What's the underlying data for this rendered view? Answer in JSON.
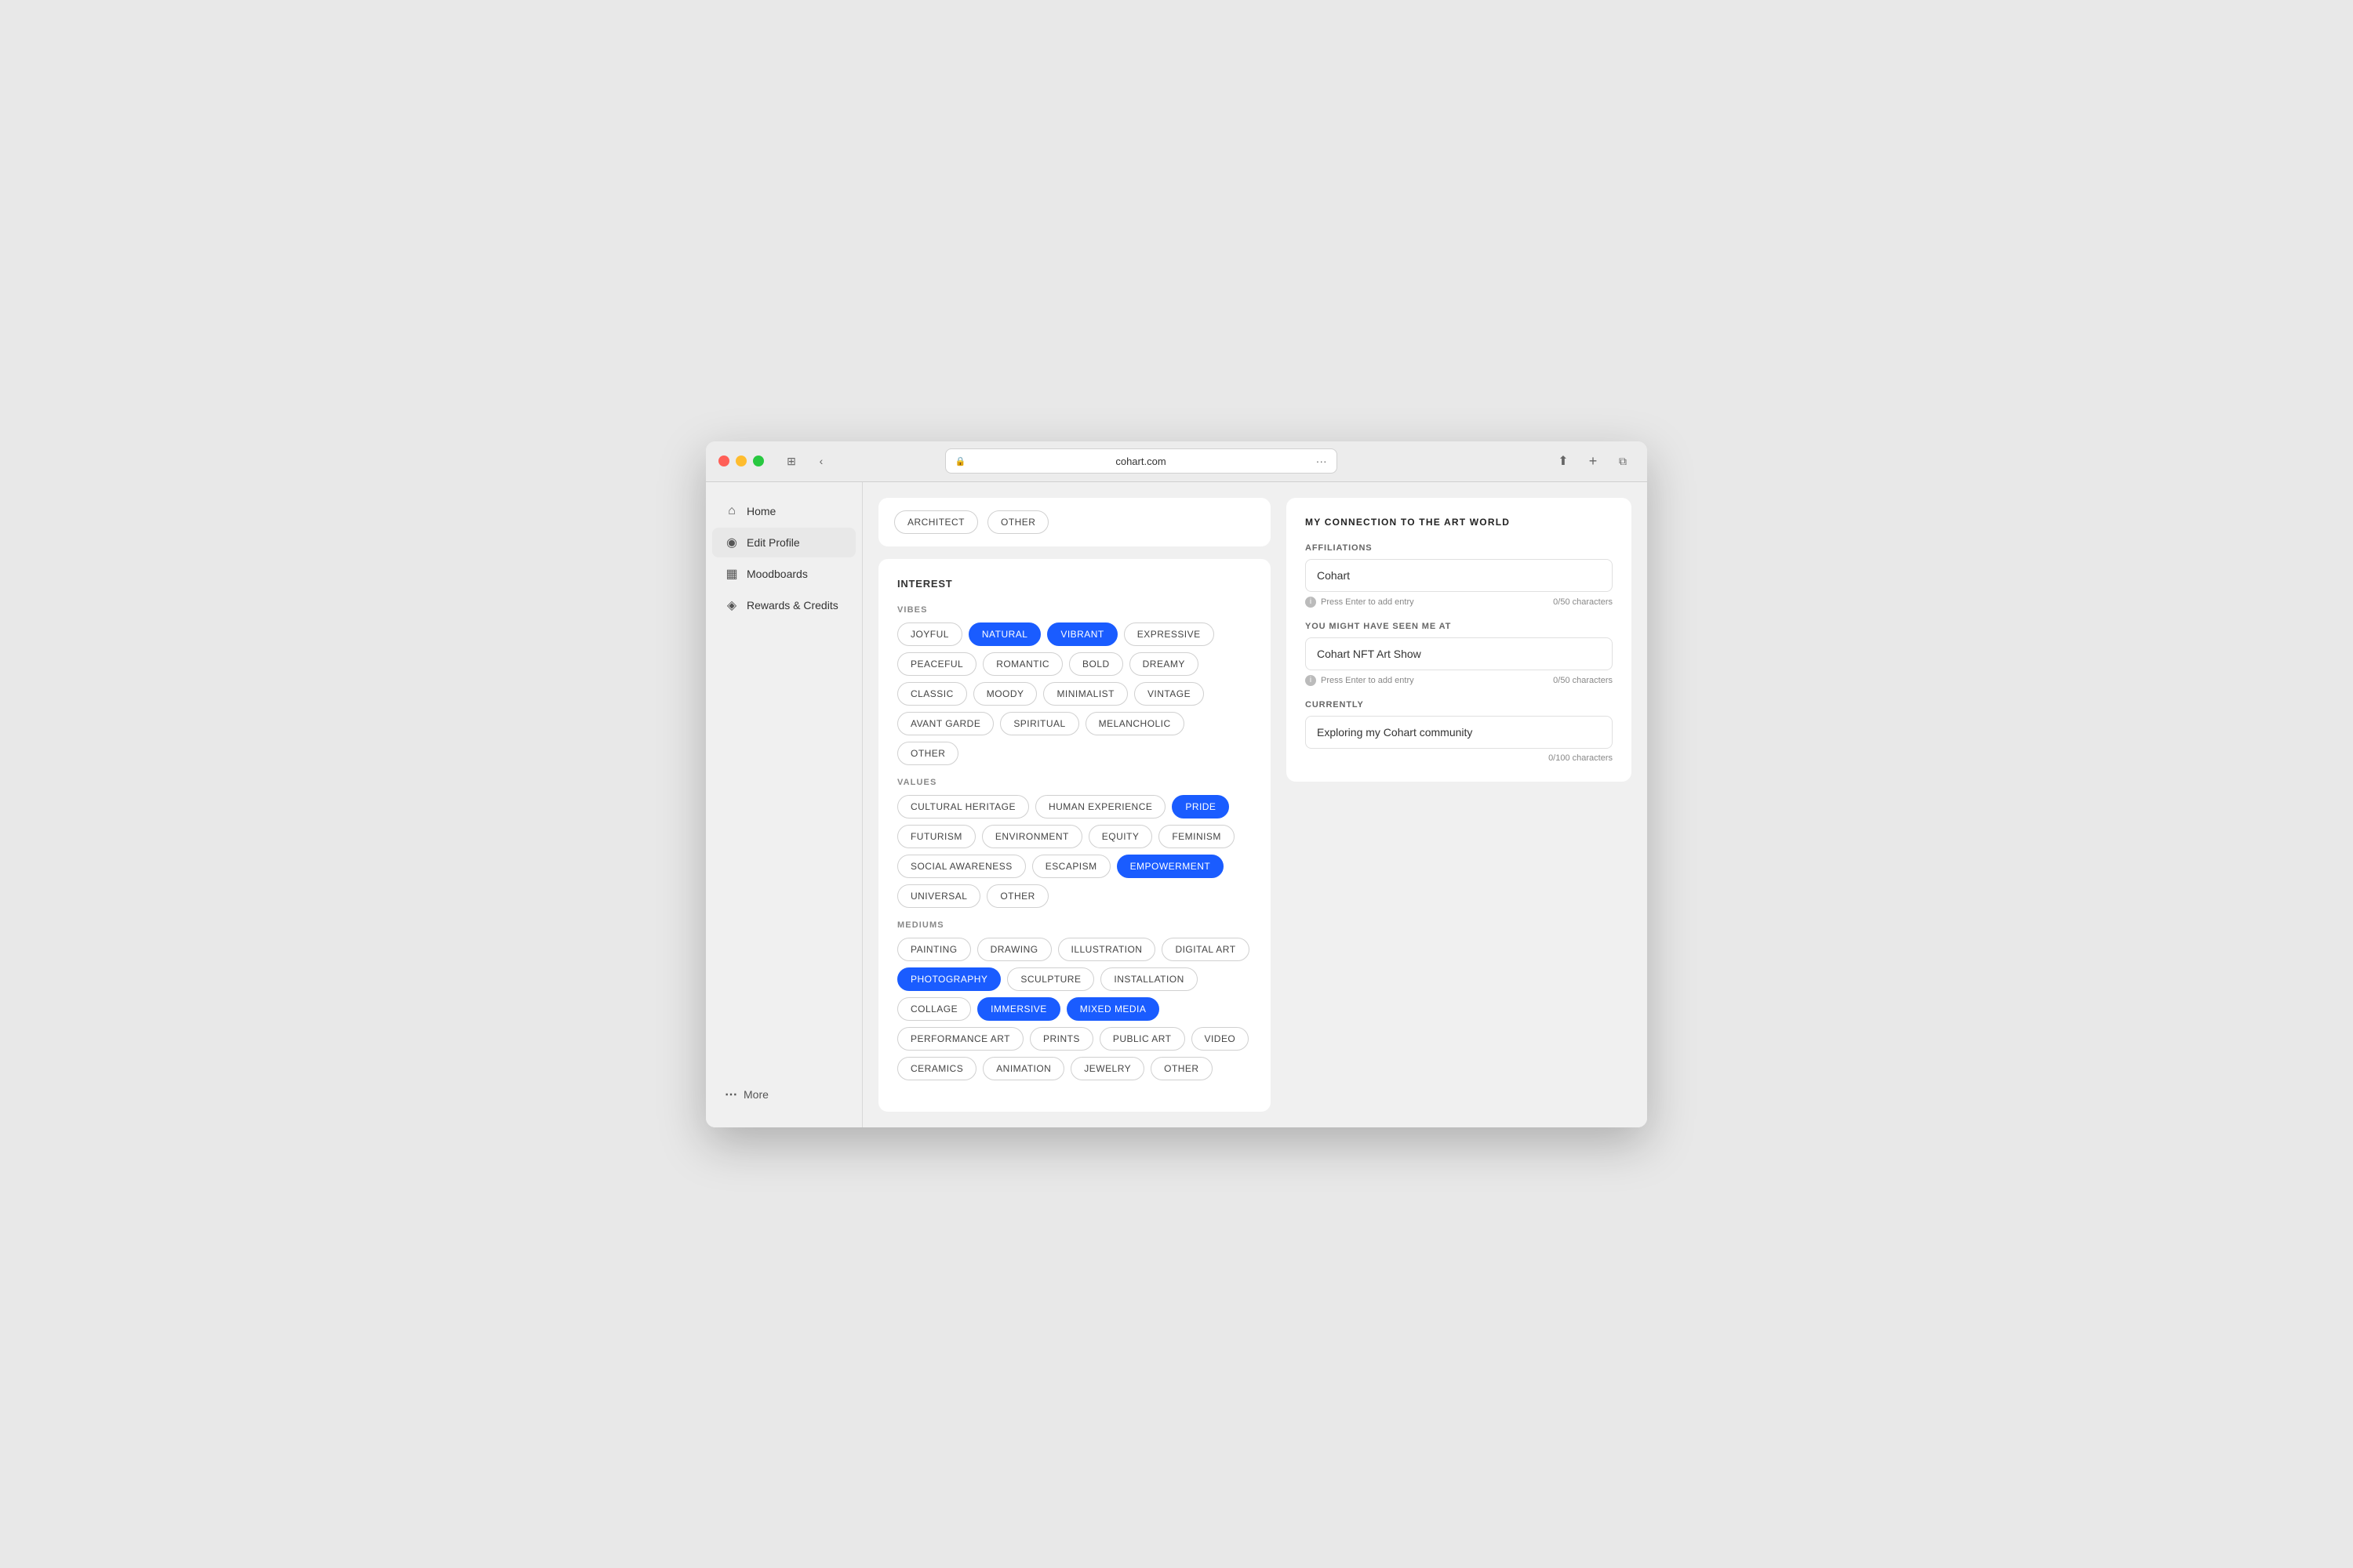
{
  "browser": {
    "url": "cohart.com",
    "lock_icon": "🔒",
    "dots_label": "···"
  },
  "sidebar": {
    "items": [
      {
        "id": "home",
        "label": "Home",
        "icon": "home",
        "active": false
      },
      {
        "id": "edit-profile",
        "label": "Edit Profile",
        "icon": "user",
        "active": true
      },
      {
        "id": "moodboards",
        "label": "Moodboards",
        "icon": "grid",
        "active": false
      },
      {
        "id": "rewards",
        "label": "Rewards & Credits",
        "icon": "gift",
        "active": false
      }
    ],
    "more_label": "More"
  },
  "top_tags": [
    {
      "label": "ARCHITECT",
      "active": false
    },
    {
      "label": "OTHER",
      "active": false
    }
  ],
  "interest": {
    "section_title": "INTEREST",
    "vibes": {
      "label": "VIBES",
      "tags": [
        {
          "label": "JOYFUL",
          "active": false
        },
        {
          "label": "NATURAL",
          "active": true
        },
        {
          "label": "VIBRANT",
          "active": true
        },
        {
          "label": "EXPRESSIVE",
          "active": false
        },
        {
          "label": "PEACEFUL",
          "active": false
        },
        {
          "label": "ROMANTIC",
          "active": false
        },
        {
          "label": "BOLD",
          "active": false
        },
        {
          "label": "DREAMY",
          "active": false
        },
        {
          "label": "CLASSIC",
          "active": false
        },
        {
          "label": "MOODY",
          "active": false
        },
        {
          "label": "MINIMALIST",
          "active": false
        },
        {
          "label": "VINTAGE",
          "active": false
        },
        {
          "label": "AVANT GARDE",
          "active": false
        },
        {
          "label": "SPIRITUAL",
          "active": false
        },
        {
          "label": "MELANCHOLIC",
          "active": false
        },
        {
          "label": "OTHER",
          "active": false
        }
      ]
    },
    "values": {
      "label": "VALUES",
      "tags": [
        {
          "label": "CULTURAL HERITAGE",
          "active": false
        },
        {
          "label": "HUMAN EXPERIENCE",
          "active": false
        },
        {
          "label": "PRIDE",
          "active": true
        },
        {
          "label": "FUTURISM",
          "active": false
        },
        {
          "label": "ENVIRONMENT",
          "active": false
        },
        {
          "label": "EQUITY",
          "active": false
        },
        {
          "label": "FEMINISM",
          "active": false
        },
        {
          "label": "SOCIAL AWARENESS",
          "active": false
        },
        {
          "label": "ESCAPISM",
          "active": false
        },
        {
          "label": "EMPOWERMENT",
          "active": true
        },
        {
          "label": "UNIVERSAL",
          "active": false
        },
        {
          "label": "OTHER",
          "active": false
        }
      ]
    },
    "mediums": {
      "label": "MEDIUMS",
      "tags": [
        {
          "label": "PAINTING",
          "active": false
        },
        {
          "label": "DRAWING",
          "active": false
        },
        {
          "label": "ILLUSTRATION",
          "active": false
        },
        {
          "label": "DIGITAL ART",
          "active": false
        },
        {
          "label": "PHOTOGRAPHY",
          "active": true
        },
        {
          "label": "SCULPTURE",
          "active": false
        },
        {
          "label": "INSTALLATION",
          "active": false
        },
        {
          "label": "COLLAGE",
          "active": false
        },
        {
          "label": "IMMERSIVE",
          "active": true
        },
        {
          "label": "MIXED MEDIA",
          "active": true
        },
        {
          "label": "PERFORMANCE ART",
          "active": false
        },
        {
          "label": "PRINTS",
          "active": false
        },
        {
          "label": "PUBLIC ART",
          "active": false
        },
        {
          "label": "VIDEO",
          "active": false
        },
        {
          "label": "CERAMICS",
          "active": false
        },
        {
          "label": "ANIMATION",
          "active": false
        },
        {
          "label": "JEWELRY",
          "active": false
        },
        {
          "label": "OTHER",
          "active": false
        }
      ]
    }
  },
  "art_world": {
    "title": "MY CONNECTION TO THE ART WORLD",
    "affiliations": {
      "label": "AFFILIATIONS",
      "value": "Cohart",
      "hint": "Press Enter to add entry",
      "char_count": "0/50 characters"
    },
    "seen_at": {
      "label": "YOU MIGHT HAVE SEEN ME AT",
      "value": "Cohart NFT Art Show",
      "hint": "Press Enter to add entry",
      "char_count": "0/50 characters"
    },
    "currently": {
      "label": "CURRENTLY",
      "value": "Exploring my Cohart community",
      "char_count": "0/100 characters"
    }
  }
}
